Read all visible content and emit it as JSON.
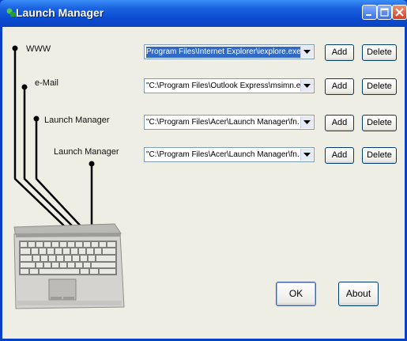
{
  "window": {
    "title": "Launch Manager"
  },
  "rows": [
    {
      "label": "WWW",
      "path": "Program Files\\Internet Explorer\\iexplore.exe\"",
      "selected": true,
      "add_label": "Add",
      "delete_label": "Delete"
    },
    {
      "label": "e-Mail",
      "path": "\"C:\\Program Files\\Outlook Express\\msimn.ex",
      "selected": false,
      "add_label": "Add",
      "delete_label": "Delete"
    },
    {
      "label": "Launch Manager",
      "path": "\"C:\\Program Files\\Acer\\Launch Manager\\fn.",
      "selected": false,
      "add_label": "Add",
      "delete_label": "Delete"
    },
    {
      "label": "Launch Manager",
      "path": "\"C:\\Program Files\\Acer\\Launch Manager\\fn.",
      "selected": false,
      "add_label": "Add",
      "delete_label": "Delete"
    }
  ],
  "footer": {
    "ok_label": "OK",
    "about_label": "About"
  },
  "icons": {
    "app": "launch-manager-icon",
    "minimize": "minimize-icon",
    "maximize": "maximize-icon",
    "close": "close-icon",
    "dropdown": "chevron-down-icon",
    "laptop": "laptop-icon"
  },
  "colors": {
    "titlebar": "#0a4ad0",
    "client": "#efeee4",
    "selection": "#316ac5",
    "close": "#d0402a"
  }
}
